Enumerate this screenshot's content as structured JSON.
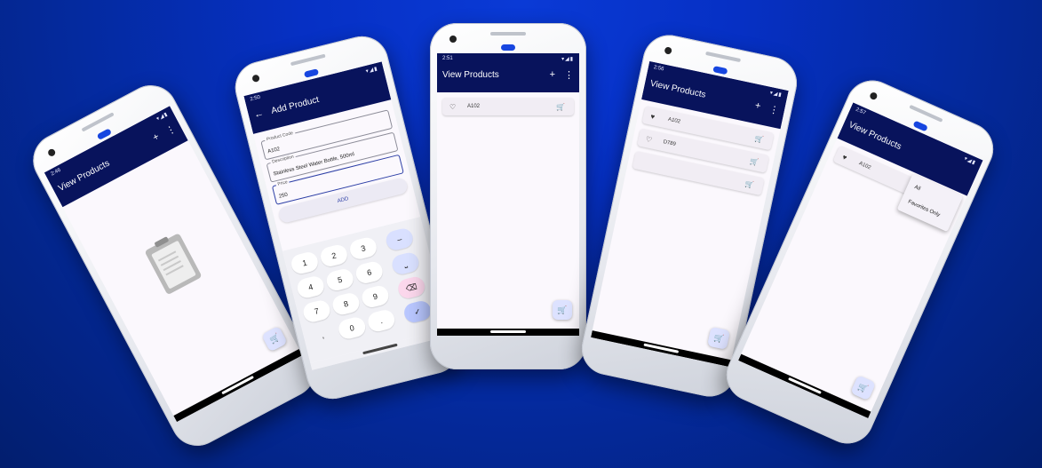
{
  "phones": {
    "p1": {
      "time": "2:46",
      "title": "View Products",
      "add": "+",
      "more": "⋮",
      "empty_icon": "clipboard-icon",
      "fab_icon": "cart-icon"
    },
    "p2": {
      "time": "2:50",
      "title": "Add Product",
      "back": "←",
      "fields": [
        {
          "label": "Product Code",
          "value": "A102"
        },
        {
          "label": "Description",
          "value": "Stainless Steel Water Bottle, 500ml"
        },
        {
          "label": "Price",
          "value": "250"
        }
      ],
      "add_button": "ADD",
      "keys": [
        "1",
        "2",
        "3",
        "4",
        "5",
        "6",
        "7",
        "8",
        "9",
        ",",
        "0",
        "."
      ],
      "side_keys": [
        "–",
        "⎵",
        "⌫",
        "✓"
      ]
    },
    "p3": {
      "time": "2:51",
      "title": "View Products",
      "add": "+",
      "more": "⋮",
      "rows": [
        {
          "code": "A102",
          "heart": "♡"
        }
      ],
      "fab_icon": "cart-icon"
    },
    "p4": {
      "time": "2:56",
      "title": "View Products",
      "add": "+",
      "more": "⋮",
      "rows": [
        {
          "code": "A102",
          "heart": "♥"
        },
        {
          "code": "D789",
          "heart": "♡"
        },
        {
          "code": "",
          "heart": ""
        }
      ],
      "fab_icon": "cart-icon"
    },
    "p5": {
      "time": "2:57",
      "title": "View Products",
      "rows": [
        {
          "code": "A102",
          "heart": "♥"
        }
      ],
      "menu": [
        "All",
        "Favorites Only"
      ],
      "fab_icon": "cart-icon"
    }
  },
  "glyphs": {
    "cart": "🛒",
    "signal": "▾◢▮"
  }
}
